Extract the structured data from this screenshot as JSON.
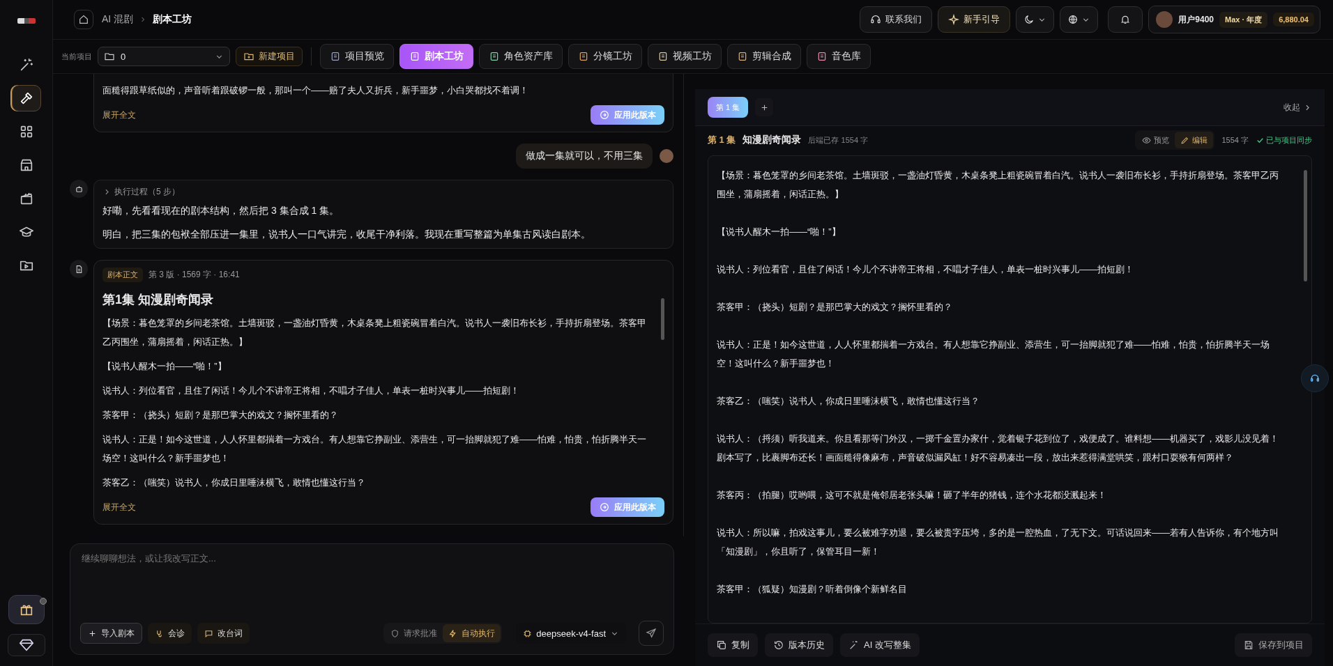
{
  "sidebar": {
    "items": [
      {
        "selected": false
      },
      {
        "selected": true
      },
      {
        "selected": false
      },
      {
        "selected": false
      },
      {
        "selected": false
      },
      {
        "selected": false
      },
      {
        "selected": false
      }
    ],
    "gift_has_dot": true
  },
  "breadcrumb": [
    "AI 混剧",
    "剧本工坊"
  ],
  "header": {
    "contact": "联系我们",
    "guide": "新手引导",
    "user": {
      "name": "用户9400",
      "plan": "Max · 年度",
      "credits": "6,880.04"
    }
  },
  "toolbar": {
    "project_label": "当前项目",
    "project_value": "0",
    "new_project": "新建项目",
    "tabs": [
      {
        "label": "项目预览",
        "selected": false
      },
      {
        "label": "剧本工坊",
        "selected": true
      },
      {
        "label": "角色资产库",
        "selected": false
      },
      {
        "label": "分镜工坊",
        "selected": false
      },
      {
        "label": "视频工坊",
        "selected": false
      },
      {
        "label": "剪辑合成",
        "selected": false
      },
      {
        "label": "音色库",
        "selected": false
      }
    ]
  },
  "chat": [
    {
      "kind": "script",
      "paragraphs": [
        "面糙得跟草纸似的，声音听着跟破锣一般，那叫一个——赔了夫人又折兵，新手噩梦，小白哭都找不着调！"
      ],
      "expand": "展开全文",
      "apply": "应用此版本"
    },
    {
      "kind": "user",
      "text": "做成一集就可以，不用三集"
    },
    {
      "kind": "assistant",
      "steps": "执行过程（5 步）",
      "paragraphs": [
        "好嘞，先看看现在的剧本结构，然后把 3 集合成 1 集。",
        "明白，把三集的包袱全部压进一集里，说书人一口气讲完，收尾干净利落。我现在重写整篇为单集古风读白剧本。"
      ]
    },
    {
      "kind": "script",
      "badge": "剧本正文",
      "meta": "第 3 版 · 1569 字 · 16:41",
      "title": "第1集 知漫剧奇闻录",
      "paragraphs": [
        "【场景：暮色笼罩的乡间老茶馆。土墙斑驳，一盏油灯昏黄，木桌条凳上粗瓷碗冒着白汽。说书人一袭旧布长衫，手持折扇登场。茶客甲乙丙围坐，蒲扇摇着，闲话正热。】",
        "【说书人醒木一拍——“啪！”】",
        "说书人：列位看官，且住了闲话！今儿个不讲帝王将相，不唱才子佳人，单表一桩时兴事儿——拍短剧！",
        "茶客甲：（挠头）短剧？是那巴掌大的戏文？搁怀里看的？",
        "说书人：正是！如今这世道，人人怀里都揣着一方戏台。有人想靠它挣副业、添营生，可一抬脚就犯了难——怕难，怕贵，怕折腾半天一场空！这叫什么？新手噩梦也！",
        "茶客乙：（嗤笑）说书人，你成日里唾沫横飞，敢情也懂这行当？"
      ],
      "expand": "展开全文",
      "apply": "应用此版本"
    }
  ],
  "composer": {
    "placeholder": "继续聊聊想法，或让我改写正文...",
    "actions": [
      "导入剧本",
      "会诊",
      "改台词"
    ],
    "modes": [
      {
        "label": "请求批准",
        "selected": false
      },
      {
        "label": "自动执行",
        "selected": true
      }
    ],
    "model": "deepseek-v4-fast"
  },
  "editor": {
    "episodes": [
      {
        "label": "第 1 集",
        "selected": true
      }
    ],
    "collapse": "收起",
    "episode": "第 1 集",
    "title": "知漫剧奇闻录",
    "saved": "后端已存 1554 字",
    "views": [
      {
        "label": "预览",
        "selected": false
      },
      {
        "label": "编辑",
        "selected": true
      }
    ],
    "count": "1554 字",
    "sync": "已与项目同步",
    "paragraphs": [
      "【场景：暮色笼罩的乡间老茶馆。土墙斑驳，一盏油灯昏黄，木桌条凳上粗瓷碗冒着白汽。说书人一袭旧布长衫，手持折扇登场。茶客甲乙丙围坐，蒲扇摇着，闲话正热。】",
      "【说书人醒木一拍——“啪！”】",
      "说书人：列位看官，且住了闲话！今儿个不讲帝王将相，不唱才子佳人，单表一桩时兴事儿——拍短剧！",
      "茶客甲：（挠头）短剧？是那巴掌大的戏文？搁怀里看的？",
      "说书人：正是！如今这世道，人人怀里都揣着一方戏台。有人想靠它挣副业、添营生，可一抬脚就犯了难——怕难，怕贵，怕折腾半天一场空！这叫什么？新手噩梦也！",
      "茶客乙：（嗤笑）说书人，你成日里唾沫横飞，敢情也懂这行当？",
      "说书人：（捋须）听我道来。你且看那等门外汉，一掷千金置办家什，觉着银子花到位了，戏便成了。谁料想——机器买了，戏影儿没见着！剧本写了，比裹脚布还长！画面糙得像麻布，声音破似漏风缸！好不容易凑出一段，放出来惹得满堂哄笑，跟村口耍猴有何两样？",
      "茶客丙：（拍腿）哎哟喂，这可不就是俺邻居老张头嘛！砸了半年的猪钱，连个水花都没溅起来！",
      "说书人：所以嘛，拍戏这事儿，要么被难字劝退，要么被贵字压垮，多的是一腔热血，了无下文。可话说回来——若有人告诉你，有个地方叫「知漫剧」，你且听了，保管耳目一新！",
      "茶客甲：（狐疑）知漫剧？听着倒像个新鲜名目"
    ],
    "footer": [
      "复制",
      "版本历史",
      "AI 改写整集"
    ],
    "save": "保存到项目"
  }
}
